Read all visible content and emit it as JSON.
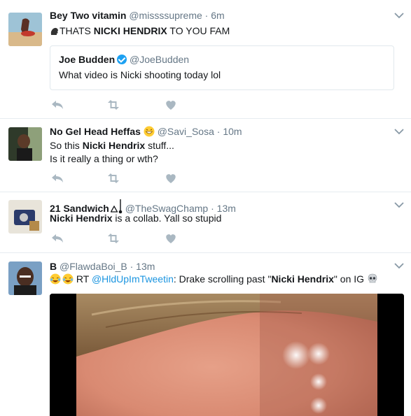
{
  "tweets": [
    {
      "fullname": "Bey Two vitamin",
      "handle": "@missssupreme",
      "time": "6m",
      "text_before": "THATS ",
      "text_bold": "NICKI HENDRIX",
      "text_after": " TO YOU FAM",
      "quote": {
        "fullname": "Joe Budden",
        "handle": "@JoeBudden",
        "text": "What video is Nicki shooting today lol"
      }
    },
    {
      "fullname": "No Gel Head Heffas",
      "handle": "@Savi_Sosa",
      "time": "10m",
      "line1_before": "So this ",
      "line1_bold": "Nicki Hendrix",
      "line1_after": " stuff...",
      "line2": "Is it really a thing or wth?"
    },
    {
      "fullname": "21 Sandwich",
      "handle": "@TheSwagChamp",
      "time": "13m",
      "text_bold": "Nicki Hendrix",
      "text_after": " is a collab. Yall so stupid"
    },
    {
      "fullname": "B",
      "handle": "@FlawdaBoi_B",
      "time": "13m",
      "text_rt": " RT ",
      "text_mention": "@HldUpImTweetin",
      "text_mid": ": Drake scrolling past \"",
      "text_bold": "Nicki Hendrix",
      "text_after": "\" on IG "
    }
  ],
  "separator": " · ",
  "icons": {
    "reply": "reply-icon",
    "retweet": "retweet-icon",
    "like": "heart-icon",
    "caret": "chevron-down-icon"
  },
  "colors": {
    "meta_gray": "#657786",
    "action_gray": "#aab8c2",
    "link_blue": "#1b95e0",
    "verified_blue": "#1da1f2",
    "divider": "#e6ecf0"
  }
}
